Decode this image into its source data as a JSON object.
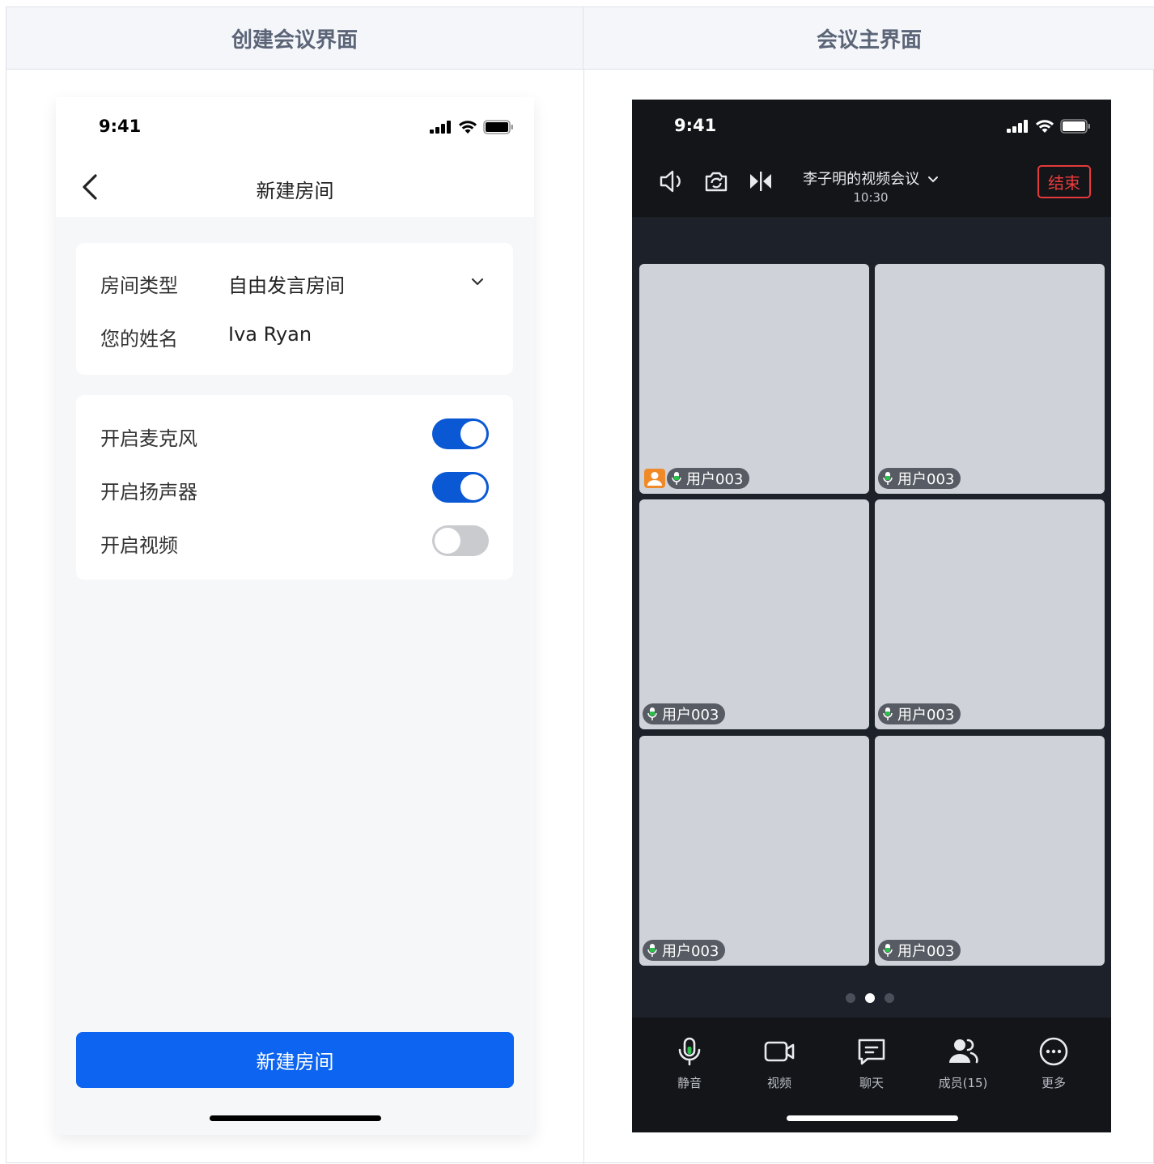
{
  "columns": {
    "left_header": "创建会议界面",
    "right_header": "会议主界面"
  },
  "create_screen": {
    "status_time": "9:41",
    "nav_title": "新建房间",
    "room_type_label": "房间类型",
    "room_type_value": "自由发言房间",
    "name_label": "您的姓名",
    "name_value": "Iva Ryan",
    "toggles": [
      {
        "label": "开启麦克风",
        "on": true
      },
      {
        "label": "开启扬声器",
        "on": true
      },
      {
        "label": "开启视频",
        "on": false
      }
    ],
    "primary_button": "新建房间",
    "accent_color": "#0C64F0"
  },
  "meeting_screen": {
    "status_time": "9:41",
    "meeting_title": "李子明的视频会议",
    "meeting_time": "10:30",
    "end_button": "结束",
    "participants": [
      {
        "name": "用户003",
        "host": true
      },
      {
        "name": "用户003",
        "host": false
      },
      {
        "name": "用户003",
        "host": false
      },
      {
        "name": "用户003",
        "host": false
      },
      {
        "name": "用户003",
        "host": false
      },
      {
        "name": "用户003",
        "host": false
      }
    ],
    "page_indicator": {
      "total": 3,
      "active": 2
    },
    "bottom_bar": [
      {
        "label": "静音",
        "icon": "microphone-icon"
      },
      {
        "label": "视频",
        "icon": "camera-icon"
      },
      {
        "label": "聊天",
        "icon": "chat-icon"
      },
      {
        "label": "成员(15)",
        "icon": "members-icon"
      },
      {
        "label": "更多",
        "icon": "more-icon"
      }
    ],
    "end_color": "#EE3B3B"
  }
}
